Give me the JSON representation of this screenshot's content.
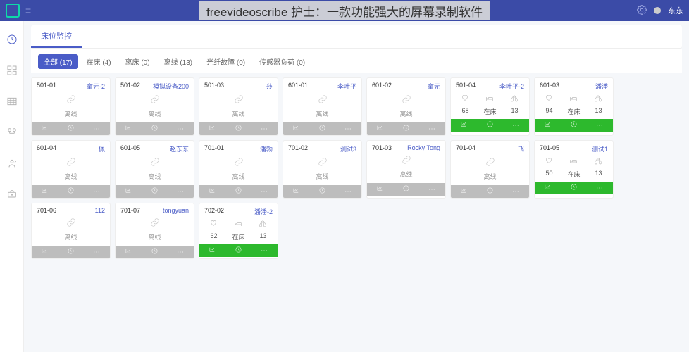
{
  "header": {
    "title_overlay": "freevideoscribe 护士：一款功能强大的屏幕录制软件",
    "username": "东东"
  },
  "tabs": [
    {
      "label": "床位监控",
      "active": true
    }
  ],
  "filters": [
    {
      "label": "全部 (17)",
      "active": true
    },
    {
      "label": "在床 (4)"
    },
    {
      "label": "离床 (0)"
    },
    {
      "label": "离线 (13)"
    },
    {
      "label": "光纤故障 (0)"
    },
    {
      "label": "传感器负荷 (0)"
    }
  ],
  "statuses": {
    "offline": "离线",
    "inbed": "在床"
  },
  "beds": [
    {
      "room": "501-01",
      "patient": "童元-2",
      "mode": "offline",
      "foot": "grey"
    },
    {
      "room": "501-02",
      "patient": "模拟设备200",
      "mode": "offline",
      "foot": "grey"
    },
    {
      "room": "501-03",
      "patient": "莎",
      "mode": "offline",
      "foot": "grey"
    },
    {
      "room": "601-01",
      "patient": "李叶平",
      "mode": "offline",
      "foot": "grey"
    },
    {
      "room": "601-02",
      "patient": "童元",
      "mode": "offline",
      "foot": "grey"
    },
    {
      "room": "501-04",
      "patient": "李叶平-2",
      "mode": "inbed",
      "hr": "68",
      "status_label": "在床",
      "rr": "13",
      "foot": "green"
    },
    {
      "room": "601-03",
      "patient": "潘潘",
      "mode": "inbed",
      "hr": "94",
      "status_label": "在床",
      "rr": "13",
      "foot": "green"
    },
    {
      "room": "601-04",
      "patient": "佩",
      "mode": "offline",
      "foot": "grey"
    },
    {
      "room": "601-05",
      "patient": "赵东东",
      "mode": "offline",
      "foot": "grey"
    },
    {
      "room": "701-01",
      "patient": "潘勃",
      "mode": "offline",
      "foot": "grey"
    },
    {
      "room": "701-02",
      "patient": "测试3",
      "mode": "offline",
      "foot": "grey"
    },
    {
      "room": "701-03",
      "patient": "Rocky Tong",
      "mode": "offline",
      "foot": "grey"
    },
    {
      "room": "701-04",
      "patient": "飞",
      "mode": "offline",
      "foot": "grey"
    },
    {
      "room": "701-05",
      "patient": "测试1",
      "mode": "inbed",
      "hr": "50",
      "status_label": "在床",
      "rr": "13",
      "foot": "green"
    },
    {
      "room": "701-06",
      "patient": "112",
      "mode": "offline",
      "foot": "grey"
    },
    {
      "room": "701-07",
      "patient": "tongyuan",
      "mode": "offline",
      "foot": "grey"
    },
    {
      "room": "702-02",
      "patient": "潘潘-2",
      "mode": "inbed",
      "hr": "62",
      "status_label": "在床",
      "rr": "13",
      "foot": "green"
    }
  ]
}
